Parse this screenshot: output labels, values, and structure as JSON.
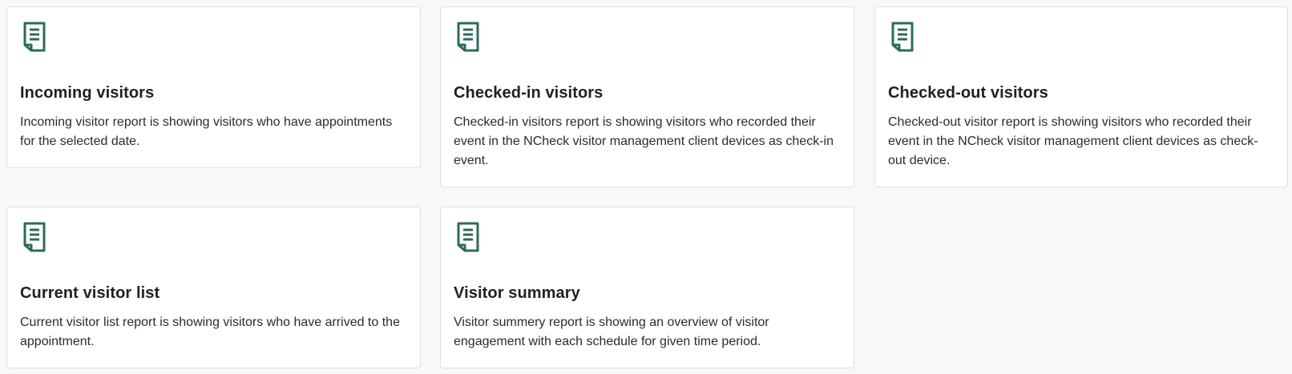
{
  "colors": {
    "icon": "#2e6b58",
    "card_background": "#ffffff",
    "card_border": "#e0e0e0",
    "page_background": "#f8f8f8"
  },
  "reports": [
    {
      "icon": "report-document-icon",
      "title": "Incoming visitors",
      "description": "Incoming visitor report is showing visitors who have appointments for the selected date."
    },
    {
      "icon": "report-document-icon",
      "title": "Checked-in visitors",
      "description": "Checked-in visitors report is showing visitors who recorded their event in the NCheck visitor management client devices as check-in event."
    },
    {
      "icon": "report-document-icon",
      "title": "Checked-out visitors",
      "description": "Checked-out visitor report is showing visitors who recorded their event in the NCheck visitor management client devices as check-out device."
    },
    {
      "icon": "report-document-icon",
      "title": "Current visitor list",
      "description": "Current visitor list report is showing visitors who have arrived to the appointment."
    },
    {
      "icon": "report-document-icon",
      "title": "Visitor summary",
      "description": "Visitor summery report is showing an overview of visitor engagement with each schedule for given time period."
    }
  ]
}
